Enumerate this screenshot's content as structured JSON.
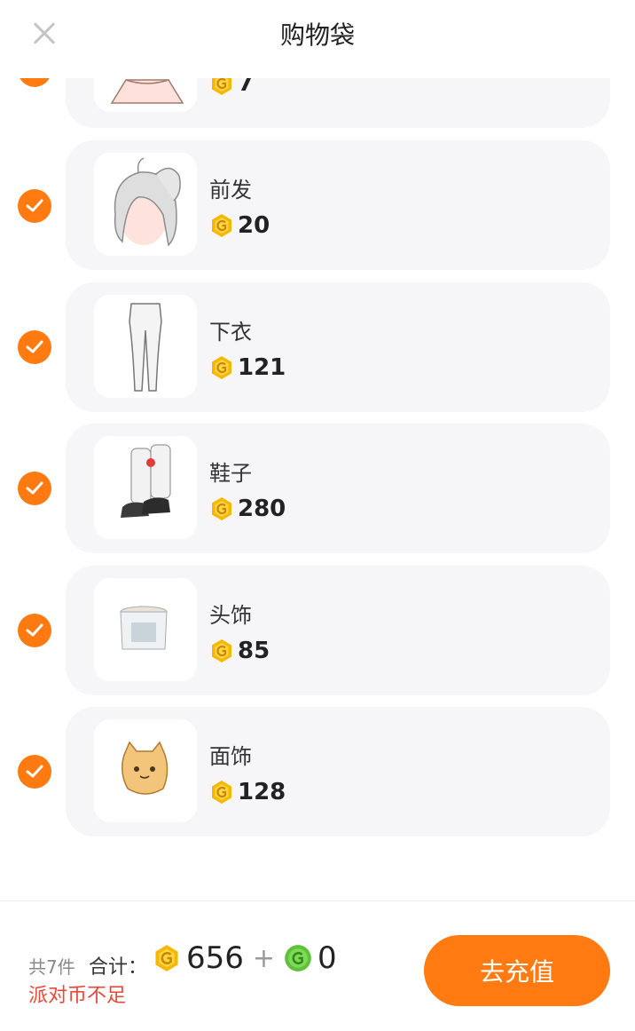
{
  "header": {
    "title": "购物袋"
  },
  "cart": {
    "items": [
      {
        "name": "",
        "price": "7",
        "checked": true
      },
      {
        "name": "前发",
        "price": "20",
        "checked": true
      },
      {
        "name": "下衣",
        "price": "121",
        "checked": true
      },
      {
        "name": "鞋子",
        "price": "280",
        "checked": true
      },
      {
        "name": "头饰",
        "price": "85",
        "checked": true
      },
      {
        "name": "面饰",
        "price": "128",
        "checked": true
      }
    ]
  },
  "footer": {
    "count": "共7件",
    "total_label": "合计：",
    "gold_total": "656",
    "plus": "+",
    "green_total": "0",
    "warning": "派对币不足",
    "recharge_label": "去充值"
  },
  "colors": {
    "accent": "#ff7b12",
    "warning": "#e34a3a",
    "gold_coin": "#f5b800",
    "green_coin": "#5dc23a"
  }
}
